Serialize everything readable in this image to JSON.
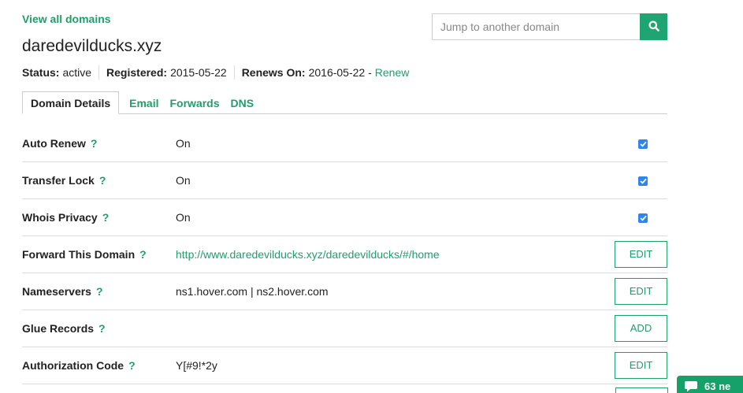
{
  "header": {
    "view_all_label": "View all domains",
    "domain": "daredevilducks.xyz"
  },
  "search": {
    "placeholder": "Jump to another domain",
    "icon": "search-icon"
  },
  "status": {
    "status_label": "Status:",
    "status_value": "active",
    "registered_label": "Registered:",
    "registered_value": "2015-05-22",
    "renews_label": "Renews On:",
    "renews_value": "2016-05-22 -",
    "renew_link": "Renew"
  },
  "tabs": [
    {
      "label": "Domain Details",
      "active": true
    },
    {
      "label": "Email",
      "active": false
    },
    {
      "label": "Forwards",
      "active": false
    },
    {
      "label": "DNS",
      "active": false
    }
  ],
  "rows": [
    {
      "label": "Auto Renew",
      "help": "?",
      "value": "On",
      "control": "checkbox",
      "checked": true
    },
    {
      "label": "Transfer Lock",
      "help": "?",
      "value": "On",
      "control": "checkbox",
      "checked": true
    },
    {
      "label": "Whois Privacy",
      "help": "?",
      "value": "On",
      "control": "checkbox",
      "checked": true
    },
    {
      "label": "Forward This Domain",
      "help": "?",
      "value": "http://www.daredevilducks.xyz/daredevilducks/#/home",
      "control": "button",
      "button_label": "EDIT"
    },
    {
      "label": "Nameservers",
      "help": "?",
      "value": "ns1.hover.com | ns2.hover.com",
      "control": "button",
      "button_label": "EDIT"
    },
    {
      "label": "Glue Records",
      "help": "?",
      "value": "",
      "control": "button",
      "button_label": "ADD"
    },
    {
      "label": "Authorization Code",
      "help": "?",
      "value": "Y[#9!*2y",
      "control": "button",
      "button_label": "EDIT"
    }
  ],
  "chat": {
    "icon": "chat-bubble-icon",
    "text": "63 ne"
  },
  "colors": {
    "accent": "#1f9f6a",
    "checkbox": "#2f86e6"
  }
}
